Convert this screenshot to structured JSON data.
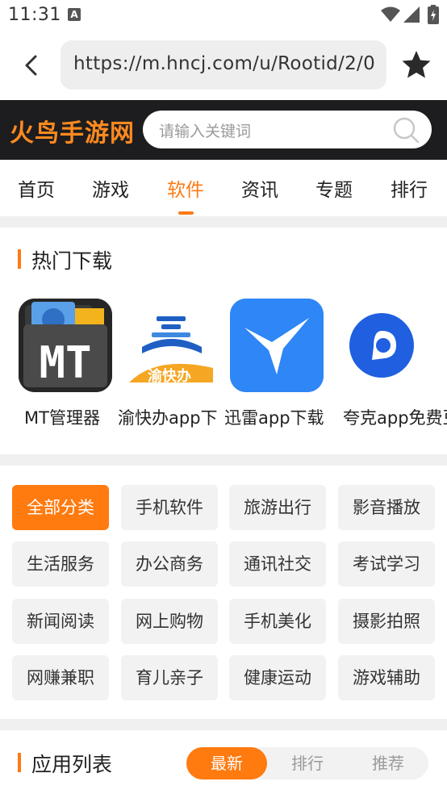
{
  "status_bar": {
    "time": "11:31",
    "notif_letter": "A"
  },
  "url_bar": {
    "url": "https://m.hncj.com/u/Rootid/2/0"
  },
  "header": {
    "logo": "火鸟手游网",
    "search_placeholder": "请输入关键词"
  },
  "nav": {
    "items": [
      {
        "label": "首页"
      },
      {
        "label": "游戏"
      },
      {
        "label": "软件"
      },
      {
        "label": "资讯"
      },
      {
        "label": "专题"
      },
      {
        "label": "排行"
      }
    ],
    "active": "软件"
  },
  "hot": {
    "title": "热门下载",
    "apps": [
      {
        "name": "MT管理器",
        "icon": "mt-manager-icon"
      },
      {
        "name": "渝快办app下",
        "icon": "yukuaiban-icon",
        "icon_text": "渝快办"
      },
      {
        "name": "迅雷app下载",
        "icon": "xunlei-icon"
      },
      {
        "name": "夸克app免费豆",
        "icon": "quark-icon"
      }
    ]
  },
  "categories": [
    {
      "label": "全部分类",
      "active": true
    },
    {
      "label": "手机软件"
    },
    {
      "label": "旅游出行"
    },
    {
      "label": "影音播放"
    },
    {
      "label": "生活服务"
    },
    {
      "label": "办公商务"
    },
    {
      "label": "通讯社交"
    },
    {
      "label": "考试学习"
    },
    {
      "label": "新闻阅读"
    },
    {
      "label": "网上购物"
    },
    {
      "label": "手机美化"
    },
    {
      "label": "摄影拍照"
    },
    {
      "label": "网赚兼职"
    },
    {
      "label": "育儿亲子"
    },
    {
      "label": "健康运动"
    },
    {
      "label": "游戏辅助"
    }
  ],
  "app_list": {
    "title": "应用列表",
    "tabs": [
      {
        "label": "最新",
        "active": true
      },
      {
        "label": "排行"
      },
      {
        "label": "推荐"
      }
    ]
  },
  "colors": {
    "accent": "#ff7a13",
    "header_bg": "#1d1d1f"
  }
}
